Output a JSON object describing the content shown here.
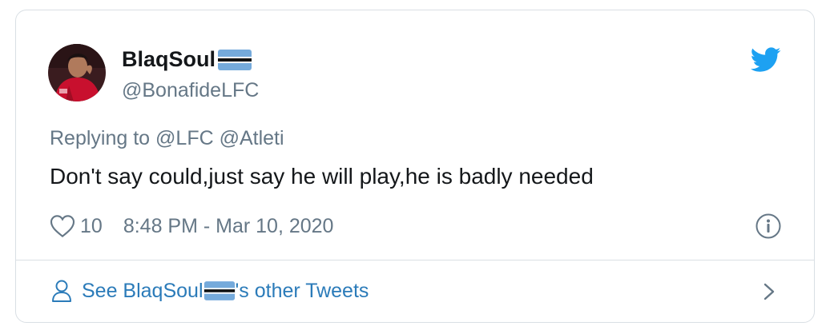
{
  "user": {
    "name": "BlaqSoul",
    "handle": "@BonafideLFC",
    "flag_icon": "botswana-flag-icon"
  },
  "tweet": {
    "replying_prefix": "Replying to",
    "reply_mentions": [
      "@LFC",
      "@Atleti"
    ],
    "text": "Don't say could,just say he will play,he is badly needed",
    "like_count": "10",
    "timestamp": "8:48 PM - Mar 10, 2020"
  },
  "footer": {
    "prefix": "See BlaqSoul",
    "suffix": "'s other Tweets"
  },
  "icons": {
    "brand": "twitter-bird-icon",
    "like": "heart-icon",
    "info": "info-icon",
    "person": "person-icon",
    "chevron": "chevron-right-icon"
  },
  "colors": {
    "twitter_blue": "#1da1f2",
    "link_blue": "#2b7bb9",
    "secondary_text": "#657786",
    "primary_text": "#14171a",
    "flag_blue": "#75aadb"
  }
}
